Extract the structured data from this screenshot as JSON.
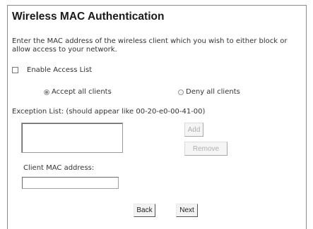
{
  "page": {
    "title": "Wireless MAC Authentication",
    "description": "Enter the MAC address of the wireless client which you wish to either block or allow access to your network."
  },
  "access_list": {
    "enable_label": "Enable Access List",
    "enabled": false
  },
  "policy": {
    "options": [
      {
        "label": "Accept all clients",
        "selected": true
      },
      {
        "label": "Deny all clients",
        "selected": false
      }
    ]
  },
  "exception_list": {
    "label": "Exception List: (should appear like 00-20-e0-00-41-00)",
    "entries": [],
    "add_label": "Add",
    "remove_label": "Remove"
  },
  "client_mac": {
    "label": "Client MAC address:",
    "value": ""
  },
  "nav": {
    "back_label": "Back",
    "next_label": "Next"
  }
}
